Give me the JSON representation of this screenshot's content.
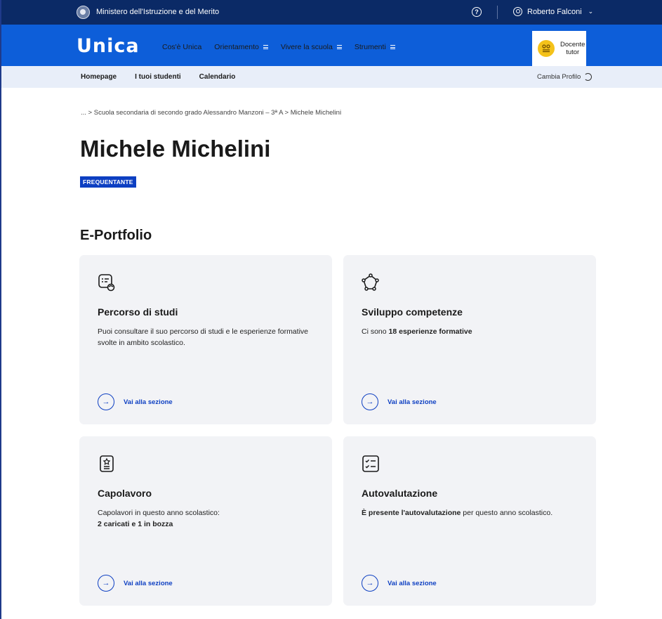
{
  "topbar": {
    "ministry": "Ministero dell'Istruzione e del Merito",
    "help_icon": "?",
    "user_name": "Roberto Falconi"
  },
  "navbar": {
    "logo": "Unica",
    "items": [
      {
        "label": "Cos'è Unica",
        "has_menu": false
      },
      {
        "label": "Orientamento",
        "has_menu": true
      },
      {
        "label": "Vivere la scuola",
        "has_menu": true
      },
      {
        "label": "Strumenti",
        "has_menu": true
      }
    ],
    "profile_role_line1": "Docente",
    "profile_role_line2": "tutor"
  },
  "subnav": {
    "items": [
      "Homepage",
      "I tuoi studenti",
      "Calendario"
    ],
    "change_profile": "Cambia Profilo"
  },
  "breadcrumb": "... > Scuola secondaria di secondo grado Alessandro Manzoni – 3ª A > Michele Michelini",
  "student": {
    "name": "Michele Michelini",
    "status": "FREQUENTANTE"
  },
  "portfolio": {
    "section_title": "E-Portfolio",
    "link_label": "Vai alla sezione",
    "cards": [
      {
        "icon": "study-path-icon",
        "title": "Percorso di studi",
        "desc": "Puoi consultare il suo percorso di studi e le esperienze formative svolte in ambito scolastico."
      },
      {
        "icon": "skills-network-icon",
        "title": "Sviluppo competenze",
        "desc_prefix": "Ci sono ",
        "desc_bold": "18 esperienze formative",
        "desc_suffix": ""
      },
      {
        "icon": "masterpiece-icon",
        "title": "Capolavoro",
        "desc_prefix": "Capolavori in questo anno scolastico:",
        "desc_bold": "2 caricati e 1 in bozza"
      },
      {
        "icon": "checklist-icon",
        "title": "Autovalutazione",
        "desc_bold": "È presente l'autovalutazione",
        "desc_suffix": " per questo anno scolastico."
      }
    ]
  },
  "colors": {
    "topbar": "#0b2a66",
    "navbar": "#0d5ed9",
    "subnav": "#e8eef9",
    "accent": "#0d3fc2",
    "card_bg": "#f2f3f6",
    "avatar": "#f4c21a"
  }
}
